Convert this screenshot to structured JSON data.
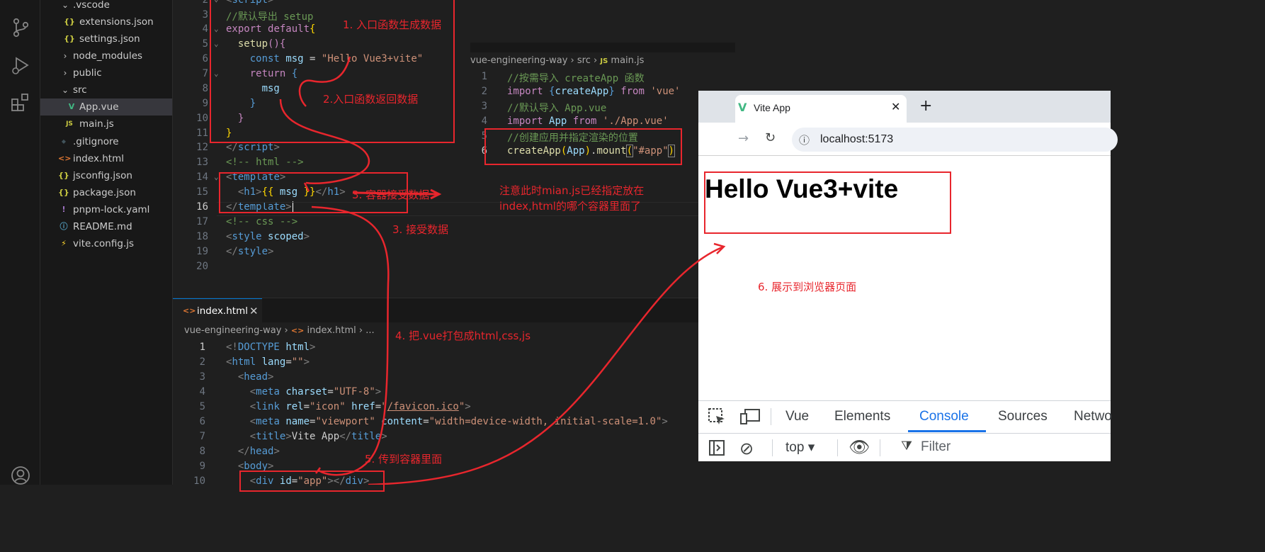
{
  "explorer": {
    "items": [
      {
        "label": ".vscode",
        "chevron": "expanded",
        "icon": ""
      },
      {
        "label": "extensions.json",
        "icon": "{}"
      },
      {
        "label": "settings.json",
        "icon": "{}"
      },
      {
        "label": "node_modules",
        "chevron": "collapsed",
        "icon": ""
      },
      {
        "label": "public",
        "chevron": "collapsed",
        "icon": ""
      },
      {
        "label": "src",
        "chevron": "expanded",
        "icon": ""
      },
      {
        "label": "App.vue",
        "icon": "V"
      },
      {
        "label": "main.js",
        "icon": "JS"
      },
      {
        "label": ".gitignore",
        "icon": "◆"
      },
      {
        "label": "index.html",
        "icon": "<>"
      },
      {
        "label": "jsconfig.json",
        "icon": "{}"
      },
      {
        "label": "package.json",
        "icon": "{}"
      },
      {
        "label": "pnpm-lock.yaml",
        "icon": "!"
      },
      {
        "label": "README.md",
        "icon": "ⓘ"
      },
      {
        "label": "vite.config.js",
        "icon": "⚡"
      }
    ]
  },
  "app_vue": {
    "line_numbers": [
      "2",
      "3",
      "4",
      "5",
      "6",
      "7",
      "8",
      "9",
      "10",
      "11",
      "12",
      "13",
      "14",
      "15",
      "16",
      "17",
      "18",
      "19",
      "20"
    ],
    "active_line": "16"
  },
  "main_js": {
    "breadcrumb": [
      "vue-engineering-way",
      "src",
      "JS",
      "main.js"
    ],
    "line_numbers": [
      "1",
      "2",
      "3",
      "4",
      "5",
      "6"
    ],
    "active_line": "6"
  },
  "index_html": {
    "tab_label": "index.html",
    "breadcrumb": [
      "vue-engineering-way",
      "index.html",
      "..."
    ],
    "line_numbers": [
      "1",
      "2",
      "3",
      "4",
      "5",
      "6",
      "7",
      "8",
      "9",
      "10"
    ],
    "active_line": "1"
  },
  "browser": {
    "tab_title": "Vite App",
    "new_tab": "+",
    "url": "localhost:5173",
    "page_heading": "Hello Vue3+vite",
    "devtools_tabs": [
      "Vue",
      "Elements",
      "Console",
      "Sources",
      "Netwo"
    ],
    "devtools_active_tab": "Console",
    "context": "top",
    "filter_placeholder": "Filter"
  },
  "annotations": {
    "a1": "1. 入口函数生成数据",
    "a2": "2.入口函数返回数据",
    "a3a": "3. 容器接受数据",
    "a3b": "3. 接受数据",
    "note1": "注意此时mian.js已经指定放在",
    "note2": "index,html的哪个容器里面了",
    "a4": "4. 把.vue打包成html,css,js",
    "a5": "5. 传到容器里面",
    "a6": "6. 展示到浏览器页面"
  },
  "colors": {
    "annotation": "#e8262d",
    "accent": "#0078d4",
    "devtools_active": "#1a73e8"
  }
}
